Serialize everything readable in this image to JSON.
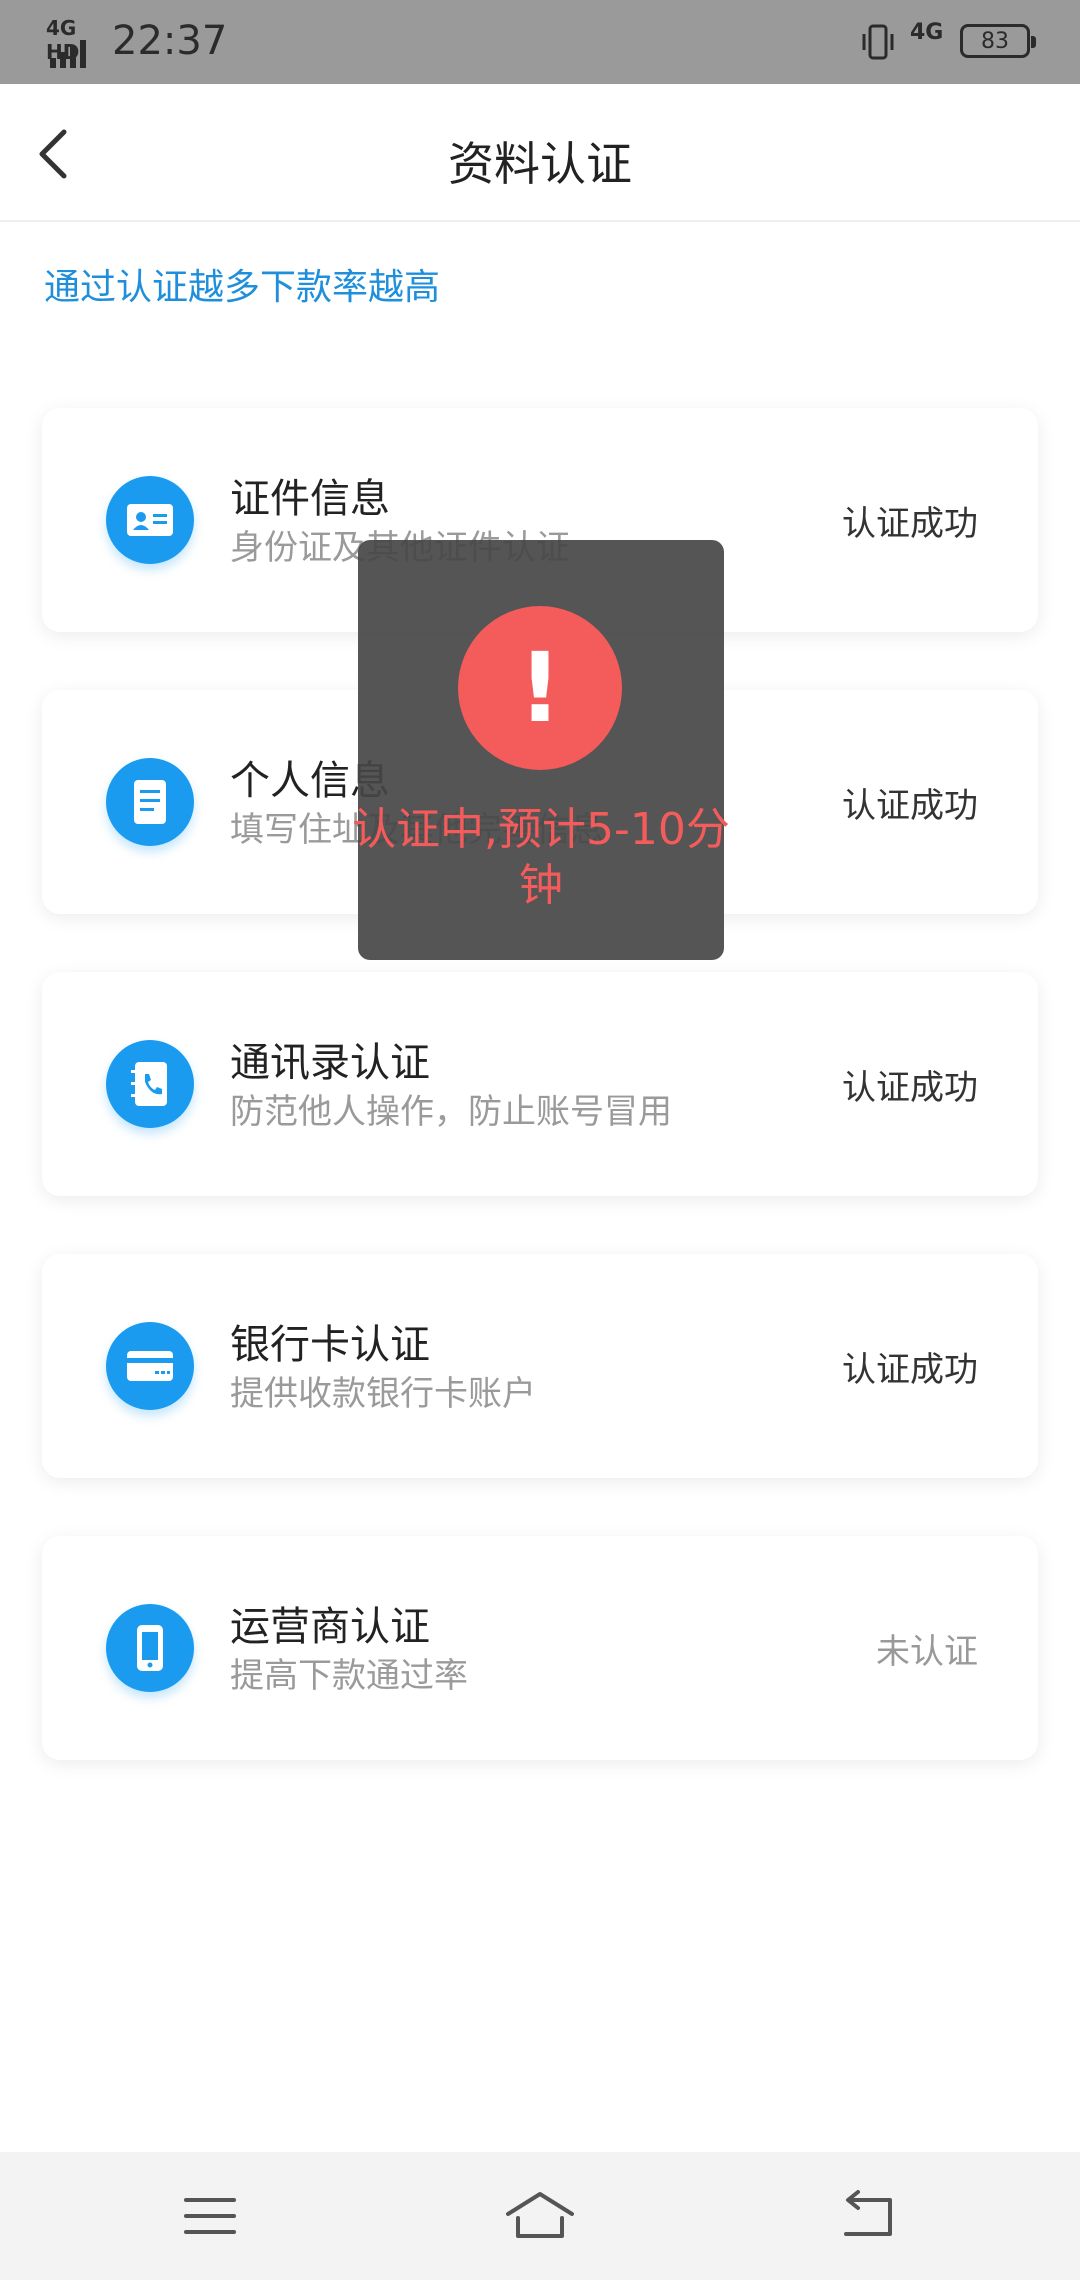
{
  "status_bar": {
    "network_left": "4G HD",
    "time": "22:37",
    "network_right": "4G",
    "battery": "83"
  },
  "header": {
    "title": "资料认证"
  },
  "hint": "通过认证越多下款率越高",
  "cards": [
    {
      "title": "证件信息",
      "subtitle": "身份证及其他证件认证",
      "status": "认证成功",
      "icon": "id-card-icon"
    },
    {
      "title": "个人信息",
      "subtitle": "填写住址及其他完善信息",
      "status": "认证成功",
      "icon": "document-icon"
    },
    {
      "title": "通讯录认证",
      "subtitle": "防范他人操作，防止账号冒用",
      "status": "认证成功",
      "icon": "phone-book-icon"
    },
    {
      "title": "银行卡认证",
      "subtitle": "提供收款银行卡账户",
      "status": "认证成功",
      "icon": "bank-card-icon"
    },
    {
      "title": "运营商认证",
      "subtitle": "提高下款通过率",
      "status": "未认证",
      "icon": "mobile-phone-icon"
    }
  ],
  "toast": {
    "icon": "!",
    "message": "认证中,预计5-10分钟"
  },
  "colors": {
    "accent": "#1a9bf0",
    "hint_text": "#1f8fdc",
    "toast_red": "#f45b5b"
  }
}
